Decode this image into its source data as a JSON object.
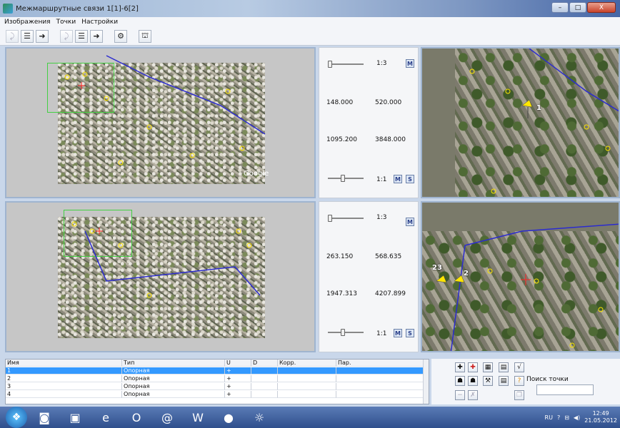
{
  "window": {
    "title": "Межмаршрутные связи 1[1]-6[2]",
    "min": "–",
    "max": "□",
    "close": "X"
  },
  "menu": [
    "Изображения",
    "Точки",
    "Настройки"
  ],
  "panes": {
    "top": {
      "zoom_small": "1:3",
      "x1": "148.000",
      "y1": "520.000",
      "x2": "1095.200",
      "y2": "3848.000",
      "zoom_large": "1:1",
      "btn_m": "M",
      "btn_s": "S",
      "google": "Google",
      "point_label": "1"
    },
    "bottom": {
      "zoom_small": "1:3",
      "x1": "263.150",
      "y1": "568.635",
      "x2": "1947.313",
      "y2": "4207.899",
      "zoom_large": "1:1",
      "btn_m": "M",
      "btn_s": "S",
      "point_labels": [
        "23",
        "2"
      ]
    }
  },
  "table": {
    "headers": [
      "Имя",
      "Тип",
      "U",
      "D",
      "Корр.",
      "Пар."
    ],
    "rows": [
      [
        "1",
        "Опорная",
        "+",
        "",
        "",
        ""
      ],
      [
        "2",
        "Опорная",
        "+",
        "",
        "",
        ""
      ],
      [
        "3",
        "Опорная",
        "+",
        "",
        "",
        ""
      ],
      [
        "4",
        "Опорная",
        "+",
        "",
        "",
        ""
      ]
    ]
  },
  "search": {
    "label": "Поиск точки",
    "value": ""
  },
  "tray": {
    "lang": "RU",
    "time": "12:49",
    "date": "21.05.2012"
  },
  "colors": {
    "viewport_box": "#44d044",
    "path": "#2b2bd0",
    "pin": "#ffe600",
    "selected_row": "#3399ff"
  }
}
